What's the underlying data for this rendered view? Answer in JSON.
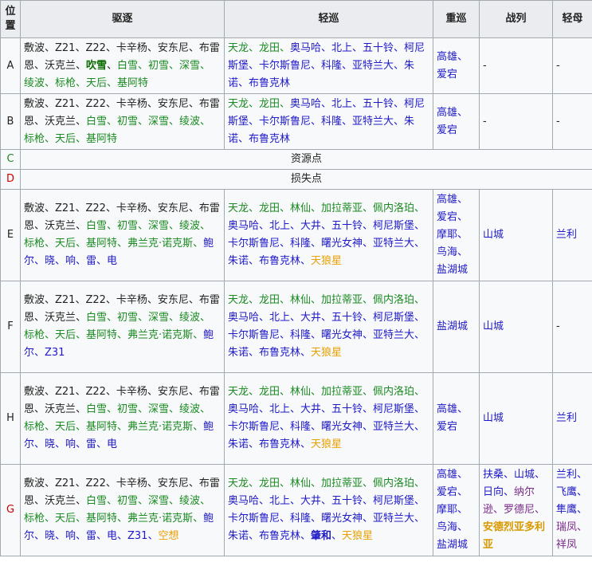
{
  "header": {
    "pos": "位置",
    "dd": "驱逐",
    "cl": "轻巡",
    "ca": "重巡",
    "bb": "战列",
    "cvl": "轻母"
  },
  "colors": {
    "black": "#222222",
    "blue": "#1f1ac8",
    "green": "#1a8a22",
    "orange": "#e8a000",
    "red": "#d00000",
    "purple": "#7a2a8a",
    "teal": "#1a7a52",
    "darkgreen": "#0a6b00",
    "gold": "#d89a00"
  },
  "rows": [
    {
      "pos": "A",
      "pos_color": "black",
      "dd": [
        {
          "t": "敷波、Z21、Z22、卡辛杨、安东尼、布雷恩、沃克兰、",
          "c": "black"
        },
        {
          "t": "吹雪",
          "c": "darkgreen",
          "b": true
        },
        {
          "t": "、",
          "c": "black"
        },
        {
          "t": "白雪、初雪、深雪、绫波、标枪、天后、基阿特",
          "c": "green"
        }
      ],
      "cl": [
        {
          "t": "天龙、龙田、",
          "c": "green"
        },
        {
          "t": "奥马哈、北上、五十铃、柯尼斯堡、卡尔斯鲁尼、科隆、亚特兰大、朱诺、布鲁克林",
          "c": "blue"
        }
      ],
      "ca": [
        {
          "t": "高雄、爱宕",
          "c": "blue"
        }
      ],
      "bb": [
        {
          "t": "-",
          "c": "black"
        }
      ],
      "cvl": [
        {
          "t": "-",
          "c": "black"
        }
      ]
    },
    {
      "pos": "B",
      "pos_color": "black",
      "dd": [
        {
          "t": "敷波、Z21、Z22、卡辛杨、安东尼、布雷恩、沃克兰、",
          "c": "black"
        },
        {
          "t": "白雪、初雪、深雪、绫波、标枪、天后、基阿特",
          "c": "green"
        }
      ],
      "cl": [
        {
          "t": "天龙、龙田、",
          "c": "green"
        },
        {
          "t": "奥马哈、北上、五十铃、柯尼斯堡、卡尔斯鲁尼、科隆、亚特兰大、朱诺、布鲁克林",
          "c": "blue"
        }
      ],
      "ca": [
        {
          "t": "高雄、爱宕",
          "c": "blue"
        }
      ],
      "bb": [
        {
          "t": "-",
          "c": "black"
        }
      ],
      "cvl": [
        {
          "t": "-",
          "c": "black"
        }
      ]
    },
    {
      "pos": "C",
      "pos_color": "green",
      "span": "资源点"
    },
    {
      "pos": "D",
      "pos_color": "red",
      "span": "损失点"
    },
    {
      "pos": "E",
      "pos_color": "black",
      "dd": [
        {
          "t": "敷波、Z21、Z22、卡辛杨、安东尼、布雷恩、沃克兰、",
          "c": "black"
        },
        {
          "t": "白雪、初雪、深雪、绫波、标枪、天后、基阿特、弗兰克·诺克斯、",
          "c": "green"
        },
        {
          "t": "鲍尔、晓、响、雷、电",
          "c": "blue"
        }
      ],
      "cl": [
        {
          "t": "天龙、龙田、林仙、加拉蒂亚、佩内洛珀、",
          "c": "green"
        },
        {
          "t": "奥马哈、北上、大井、五十铃、柯尼斯堡、卡尔斯鲁尼、科隆、曙光女神、亚特兰大、朱诺、布鲁克林、",
          "c": "blue"
        },
        {
          "t": "天狼星",
          "c": "orange"
        }
      ],
      "ca": [
        {
          "t": "高雄、爱宕、摩耶、鸟海、盐湖城",
          "c": "blue"
        }
      ],
      "bb": [
        {
          "t": "山城",
          "c": "blue"
        }
      ],
      "cvl": [
        {
          "t": "兰利",
          "c": "blue"
        }
      ]
    },
    {
      "pos": "F",
      "pos_color": "black",
      "dd": [
        {
          "t": "敷波、Z21、Z22、卡辛杨、安东尼、布雷恩、沃克兰、",
          "c": "black"
        },
        {
          "t": "白雪、初雪、深雪、绫波、标枪、天后、基阿特、弗兰克·诺克斯、",
          "c": "green"
        },
        {
          "t": "鲍尔、Z31",
          "c": "blue"
        }
      ],
      "cl": [
        {
          "t": "天龙、龙田、林仙、加拉蒂亚、佩内洛珀、",
          "c": "green"
        },
        {
          "t": "奥马哈、北上、大井、五十铃、柯尼斯堡、卡尔斯鲁尼、科隆、曙光女神、亚特兰大、朱诺、布鲁克林、",
          "c": "blue"
        },
        {
          "t": "天狼星",
          "c": "orange"
        }
      ],
      "ca": [
        {
          "t": "盐湖城",
          "c": "blue"
        }
      ],
      "bb": [
        {
          "t": "山城",
          "c": "blue"
        }
      ],
      "cvl": [
        {
          "t": "-",
          "c": "black"
        }
      ]
    },
    {
      "pos": "H",
      "pos_color": "black",
      "dd": [
        {
          "t": "敷波、Z21、Z22、卡辛杨、安东尼、布雷恩、沃克兰、",
          "c": "black"
        },
        {
          "t": "白雪、初雪、深雪、绫波、标枪、天后、基阿特、弗兰克·诺克斯、",
          "c": "green"
        },
        {
          "t": "鲍尔、晓、响、雷、电",
          "c": "blue"
        }
      ],
      "cl": [
        {
          "t": "天龙、龙田、林仙、加拉蒂亚、佩内洛珀、",
          "c": "green"
        },
        {
          "t": "奥马哈、北上、大井、五十铃、柯尼斯堡、卡尔斯鲁尼、科隆、曙光女神、亚特兰大、朱诺、布鲁克林、",
          "c": "blue"
        },
        {
          "t": "天狼星",
          "c": "orange"
        }
      ],
      "ca": [
        {
          "t": "高雄、爱宕",
          "c": "blue"
        }
      ],
      "bb": [
        {
          "t": "山城",
          "c": "blue"
        }
      ],
      "cvl": [
        {
          "t": "兰利",
          "c": "blue"
        }
      ]
    },
    {
      "pos": "G",
      "pos_color": "red",
      "dd": [
        {
          "t": "敷波、Z21、Z22、卡辛杨、安东尼、布雷恩、沃克兰、",
          "c": "black"
        },
        {
          "t": "白雪、初雪、深雪、绫波、标枪、天后、基阿特、弗兰克·诺克斯、",
          "c": "green"
        },
        {
          "t": "鲍尔、晓、响、雷、电、Z31、",
          "c": "blue"
        },
        {
          "t": "空想",
          "c": "orange"
        }
      ],
      "cl": [
        {
          "t": "天龙、龙田、林仙、加拉蒂亚、佩内洛珀、",
          "c": "green"
        },
        {
          "t": "奥马哈、北上、大井、五十铃、柯尼斯堡、卡尔斯鲁尼、科隆、曙光女神、亚特兰大、朱诺、布鲁克林、",
          "c": "blue"
        },
        {
          "t": "肇和",
          "c": "blue",
          "b": true
        },
        {
          "t": "、",
          "c": "blue"
        },
        {
          "t": "天狼星",
          "c": "orange"
        }
      ],
      "ca": [
        {
          "t": "高雄、爱宕、摩耶、鸟海、盐湖城",
          "c": "blue"
        }
      ],
      "bb": [
        {
          "t": "扶桑、山城、日向、",
          "c": "blue"
        },
        {
          "t": "纳尔逊、罗德尼、",
          "c": "purple"
        },
        {
          "t": "安德烈亚多利亚",
          "c": "gold",
          "b": true
        }
      ],
      "cvl": [
        {
          "t": "兰利、飞鹰、隼鹰、",
          "c": "blue"
        },
        {
          "t": "瑞凤、祥凤",
          "c": "purple"
        }
      ]
    }
  ]
}
